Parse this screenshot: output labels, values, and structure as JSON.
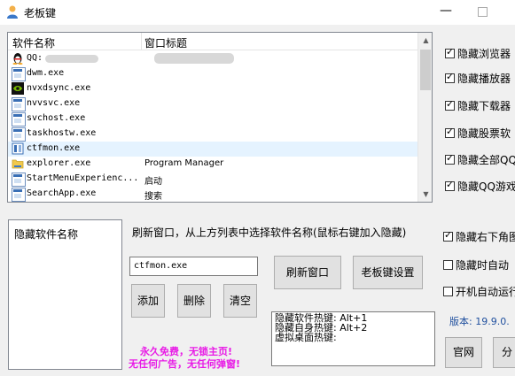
{
  "window": {
    "title": "老板键"
  },
  "process_list": {
    "columns": [
      "软件名称",
      "窗口标题"
    ],
    "rows": [
      {
        "name": "QQ:",
        "title": "",
        "icon": "qq-penguin-icon",
        "redacted": true
      },
      {
        "name": "dwm.exe",
        "title": "",
        "icon": "exe-icon"
      },
      {
        "name": "nvxdsync.exe",
        "title": "",
        "icon": "nvidia-icon"
      },
      {
        "name": "nvvsvc.exe",
        "title": "",
        "icon": "exe-icon"
      },
      {
        "name": "svchost.exe",
        "title": "",
        "icon": "exe-icon"
      },
      {
        "name": "taskhostw.exe",
        "title": "",
        "icon": "exe-icon"
      },
      {
        "name": "ctfmon.exe",
        "title": "",
        "icon": "ctfmon-icon",
        "selected": true
      },
      {
        "name": "explorer.exe",
        "title": "Program Manager",
        "icon": "folder-icon"
      },
      {
        "name": "StartMenuExperienc...",
        "title": "启动",
        "icon": "exe-icon"
      },
      {
        "name": "SearchApp.exe",
        "title": "搜索",
        "icon": "exe-icon"
      }
    ]
  },
  "hidden_list": {
    "header": "隐藏软件名称"
  },
  "hint": "刷新窗口，从上方列表中选择软件名称(鼠标右键加入隐藏)",
  "selected_input": {
    "value": "ctfmon.exe"
  },
  "buttons": {
    "refresh": "刷新窗口",
    "settings": "老板键设置",
    "add": "添加",
    "delete": "删除",
    "clear": "清空",
    "website": "官网",
    "share": "分"
  },
  "hotkeys": {
    "line1": "隐藏软件热键: Alt+1",
    "line2": "隐藏自身热键: Alt+2",
    "line3": "虚拟桌面热键:"
  },
  "promo": {
    "line1": "永久免费，无锁主页!",
    "line2": "无任何广告，无任何弹窗!"
  },
  "right_checkboxes": [
    {
      "label": "隐藏浏览器",
      "checked": true
    },
    {
      "label": "隐藏播放器",
      "checked": true
    },
    {
      "label": "隐藏下载器",
      "checked": true
    },
    {
      "label": "隐藏股票软",
      "checked": true
    },
    {
      "label": "隐藏全部QQ",
      "checked": true
    },
    {
      "label": "隐藏QQ游戏",
      "checked": true
    }
  ],
  "bottom_checkboxes": [
    {
      "label": "隐藏右下角图",
      "checked": true
    },
    {
      "label": "隐藏时自动",
      "checked": false
    },
    {
      "label": "开机自动运行",
      "checked": false
    }
  ],
  "version": "版本: 19.9.0.",
  "colors": {
    "promo": "#e81ae6",
    "version": "#1f4f9e",
    "selected_row": "#e5f3ff"
  }
}
